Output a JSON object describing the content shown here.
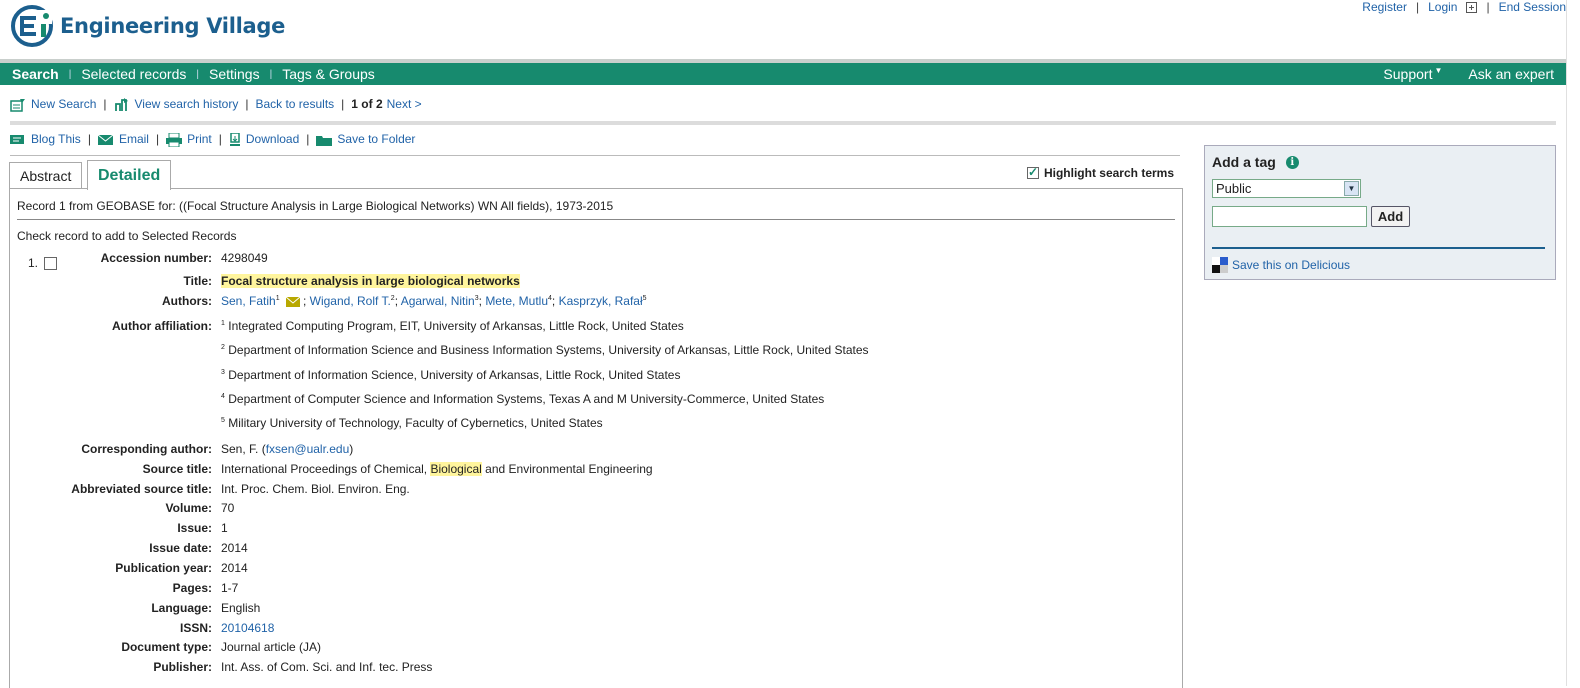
{
  "brand": {
    "name": "Engineering Village",
    "colors": {
      "primary": "#178a6e",
      "logo": "#1c5f8e",
      "link": "#2163a8",
      "highlight": "#fff59d"
    }
  },
  "top_links": {
    "register": "Register",
    "login": "Login",
    "end_session": "End Session"
  },
  "nav": {
    "items": [
      "Search",
      "Selected records",
      "Settings",
      "Tags & Groups"
    ],
    "support": "Support",
    "ask_expert": "Ask an expert"
  },
  "toolbar1": {
    "new_search": "New Search",
    "view_history": "View search history",
    "back_to_results": "Back to results",
    "position": "1 of 2",
    "next": "Next >"
  },
  "toolbar2": {
    "blog": "Blog This",
    "email": "Email",
    "print": "Print",
    "download": "Download",
    "save_folder": "Save to Folder"
  },
  "tabs": {
    "abstract": "Abstract",
    "detailed": "Detailed"
  },
  "highlight_label": "Highlight search terms",
  "record_line": "Record 1 from GEOBASE for: ((Focal Structure Analysis in Large Biological Networks) WN All fields), 1973-2015",
  "check_line": "Check record to add to Selected Records",
  "record_number": "1.",
  "labels": {
    "accession": "Accession number:",
    "title": "Title:",
    "authors": "Authors:",
    "affiliation": "Author affiliation:",
    "corresponding": "Corresponding author:",
    "source_title": "Source title:",
    "abbrev_source": "Abbreviated source title:",
    "volume": "Volume:",
    "issue": "Issue:",
    "issue_date": "Issue date:",
    "pub_year": "Publication year:",
    "pages": "Pages:",
    "language": "Language:",
    "issn": "ISSN:",
    "doc_type": "Document type:",
    "publisher": "Publisher:"
  },
  "record": {
    "accession": "4298049",
    "title": "Focal structure analysis in large biological networks",
    "authors": [
      {
        "name": "Sen, Fatih",
        "sup": "1"
      },
      {
        "name": "Wigand, Rolf T.",
        "sup": "2"
      },
      {
        "name": "Agarwal, Nitin",
        "sup": "3"
      },
      {
        "name": "Mete, Mutlu",
        "sup": "4"
      },
      {
        "name": "Kasprzyk, Rafał",
        "sup": "5"
      }
    ],
    "affiliations": [
      {
        "sup": "1",
        "text": "Integrated Computing Program, EIT, University of Arkansas, Little Rock, United States"
      },
      {
        "sup": "2",
        "text": "Department of Information Science and Business Information Systems, University of Arkansas, Little Rock, United States"
      },
      {
        "sup": "3",
        "text": "Department of Information Science, University of Arkansas, Little Rock, United States"
      },
      {
        "sup": "4",
        "text": "Department of Computer Science and Information Systems, Texas A and M University-Commerce, United States"
      },
      {
        "sup": "5",
        "text": "Military University of Technology, Faculty of Cybernetics, United States"
      }
    ],
    "corresponding_name": "Sen, F.",
    "corresponding_email": "fxsen@ualr.edu",
    "source_title_pre": "International Proceedings of Chemical, ",
    "source_title_hl": "Biological",
    "source_title_post": " and Environmental Engineering",
    "abbrev_source": "Int. Proc. Chem. Biol. Environ. Eng.",
    "volume": "70",
    "issue": "1",
    "issue_date": "2014",
    "pub_year": "2014",
    "pages": "1-7",
    "language": "English",
    "issn": "20104618",
    "doc_type": "Journal article (JA)",
    "publisher": "Int. Ass. of Com. Sci. and Inf. tec. Press"
  },
  "tag_box": {
    "title": "Add a tag",
    "visibility": "Public",
    "add_label": "Add",
    "delicious": "Save this on Delicious"
  }
}
